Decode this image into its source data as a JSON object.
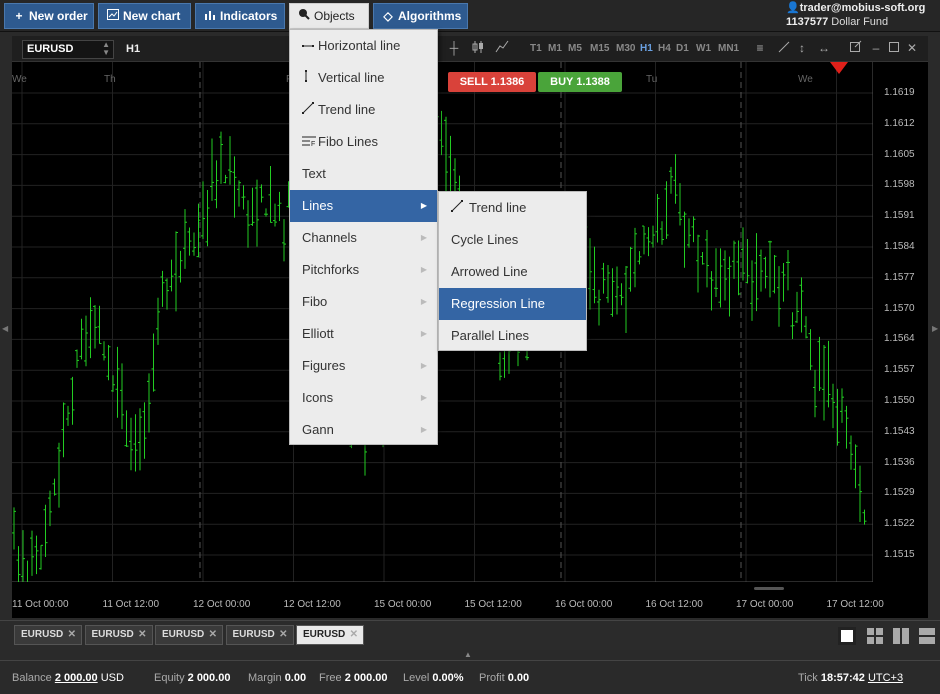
{
  "toolbar": {
    "new_order": "New order",
    "new_chart": "New chart",
    "indicators": "Indicators",
    "objects": "Objects",
    "algorithms": "Algorithms"
  },
  "account": {
    "user": "trader@mobius-soft.org",
    "number": "1137577",
    "fund": "Dollar Fund"
  },
  "chart_toolbar": {
    "symbol": "EURUSD",
    "timeframe": "H1",
    "timeframes": [
      "T1",
      "M1",
      "M5",
      "M15",
      "M30",
      "H1",
      "H4",
      "D1",
      "W1",
      "MN1"
    ],
    "selected_timeframe": "H1"
  },
  "chart": {
    "day_labels": [
      "We",
      "Th",
      "Fr",
      "Tu",
      "We"
    ],
    "y_ticks": [
      "1.1619",
      "1.1612",
      "1.1605",
      "1.1598",
      "1.1591",
      "1.1584",
      "1.1577",
      "1.1570",
      "1.1564",
      "1.1557",
      "1.1550",
      "1.1543",
      "1.1536",
      "1.1529",
      "1.1522",
      "1.1515"
    ],
    "x_ticks": [
      "11 Oct 00:00",
      "11 Oct 12:00",
      "12 Oct 00:00",
      "12 Oct 12:00",
      "15 Oct 00:00",
      "15 Oct 12:00",
      "16 Oct 00:00",
      "16 Oct 12:00",
      "17 Oct 00:00",
      "17 Oct 12:00"
    ],
    "sell": "SELL 1.1386",
    "buy": "BUY 1.1388",
    "candle_color": "#22cc22"
  },
  "chart_data": {
    "type": "ohlc",
    "ylim": [
      1.1512,
      1.1622
    ],
    "seed": 17,
    "bars": 190
  },
  "menu": {
    "items": [
      {
        "label": "Horizontal line",
        "icon": "horizontal-line-icon",
        "has_sub": false
      },
      {
        "label": "Vertical line",
        "icon": "vertical-line-icon",
        "has_sub": false
      },
      {
        "label": "Trend line",
        "icon": "trend-line-icon",
        "has_sub": false
      },
      {
        "label": "Fibo Lines",
        "icon": "fibo-lines-icon",
        "has_sub": false
      },
      {
        "label": "Text",
        "icon": "",
        "has_sub": false
      },
      {
        "label": "Lines",
        "icon": "",
        "has_sub": true
      },
      {
        "label": "Channels",
        "icon": "",
        "has_sub": true
      },
      {
        "label": "Pitchforks",
        "icon": "",
        "has_sub": true
      },
      {
        "label": "Fibo",
        "icon": "",
        "has_sub": true
      },
      {
        "label": "Elliott",
        "icon": "",
        "has_sub": true
      },
      {
        "label": "Figures",
        "icon": "",
        "has_sub": true
      },
      {
        "label": "Icons",
        "icon": "",
        "has_sub": true
      },
      {
        "label": "Gann",
        "icon": "",
        "has_sub": true
      }
    ],
    "selected": 5,
    "submenu": [
      "Trend line",
      "Cycle Lines",
      "Arrowed Line",
      "Regression Line",
      "Parallel Lines"
    ],
    "submenu_selected": 3
  },
  "tabs": [
    "EURUSD",
    "EURUSD",
    "EURUSD",
    "EURUSD",
    "EURUSD"
  ],
  "active_tab": 4,
  "status": {
    "balance_label": "Balance",
    "balance": "2 000.00",
    "balance_cur": "USD",
    "equity_label": "Equity",
    "equity": "2 000.00",
    "margin_label": "Margin",
    "margin": "0.00",
    "free_label": "Free",
    "free": "2 000.00",
    "level_label": "Level",
    "level": "0.00%",
    "profit_label": "Profit",
    "profit": "0.00",
    "tick_label": "Tick",
    "time": "18:57:42",
    "tz": "UTC+3"
  }
}
